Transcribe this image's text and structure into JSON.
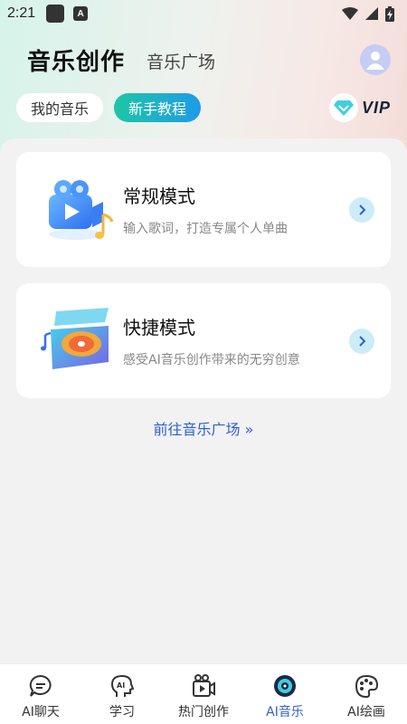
{
  "status_bar": {
    "time": "2:21",
    "app_badge": "A"
  },
  "header": {
    "title": "音乐创作",
    "subtitle_tab": "音乐广场"
  },
  "chips": {
    "my_music": "我的音乐",
    "tutorial": "新手教程"
  },
  "vip": {
    "label": "VIP",
    "accent": "#2ec9d6"
  },
  "cards": [
    {
      "title": "常规模式",
      "desc": "输入歌词，打造专属个人单曲",
      "illustration": "video-camera-music-icon"
    },
    {
      "title": "快捷模式",
      "desc": "感受AI音乐创作带来的无穷创意",
      "illustration": "vinyl-record-box-icon"
    }
  ],
  "goto_link": "前往音乐广场 »",
  "tabs": [
    {
      "label": "AI聊天",
      "icon": "chat-bubble-icon",
      "active": false
    },
    {
      "label": "学习",
      "icon": "ai-head-icon",
      "active": false
    },
    {
      "label": "热门创作",
      "icon": "video-camera-icon",
      "active": false
    },
    {
      "label": "AI音乐",
      "icon": "music-disc-icon",
      "active": true
    },
    {
      "label": "AI绘画",
      "icon": "palette-icon",
      "active": false
    }
  ],
  "colors": {
    "accent_blue": "#2f5fcf",
    "tutorial_gradient_start": "#1ec6a6",
    "tutorial_gradient_end": "#1e9be8"
  }
}
